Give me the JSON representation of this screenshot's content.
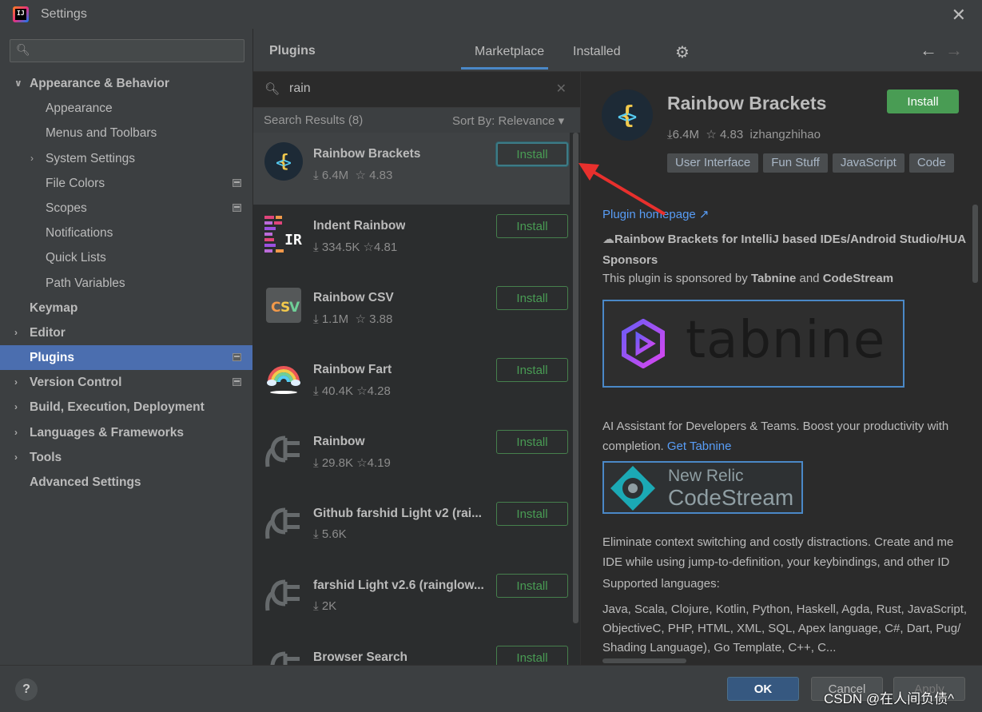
{
  "window": {
    "title": "Settings",
    "app_icon_text": "IJ"
  },
  "sidebar": {
    "search_placeholder": "",
    "items": [
      {
        "label": "Appearance & Behavior",
        "expanded": true
      },
      {
        "label": "Appearance"
      },
      {
        "label": "Menus and Toolbars"
      },
      {
        "label": "System Settings"
      },
      {
        "label": "File Colors"
      },
      {
        "label": "Scopes"
      },
      {
        "label": "Notifications"
      },
      {
        "label": "Quick Lists"
      },
      {
        "label": "Path Variables"
      },
      {
        "label": "Keymap"
      },
      {
        "label": "Editor"
      },
      {
        "label": "Plugins",
        "selected": true
      },
      {
        "label": "Version Control"
      },
      {
        "label": "Build, Execution, Deployment"
      },
      {
        "label": "Languages & Frameworks"
      },
      {
        "label": "Tools"
      },
      {
        "label": "Advanced Settings"
      }
    ]
  },
  "plugins_header": {
    "title": "Plugins",
    "tabs": [
      {
        "label": "Marketplace",
        "active": true
      },
      {
        "label": "Installed"
      }
    ]
  },
  "search": {
    "query": "rain",
    "results_label": "Search Results (8)",
    "sort_label": "Sort By: Relevance"
  },
  "plugins": [
    {
      "name": "Rainbow Brackets",
      "downloads": "6.4M",
      "rating": "4.83",
      "install": "Install",
      "icon": "rainbow-brackets-icon"
    },
    {
      "name": "Indent Rainbow",
      "downloads": "334.5K",
      "rating": "4.81",
      "install": "Install",
      "icon": "indent-rainbow-icon"
    },
    {
      "name": "Rainbow CSV",
      "downloads": "1.1M",
      "rating": "3.88",
      "install": "Install",
      "icon": "csv-icon"
    },
    {
      "name": "Rainbow Fart",
      "downloads": "40.4K",
      "rating": "4.28",
      "install": "Install",
      "icon": "rainbow-icon"
    },
    {
      "name": "Rainbow",
      "downloads": "29.8K",
      "rating": "4.19",
      "install": "Install",
      "icon": "plug-icon"
    },
    {
      "name": "Github farshid Light v2 (rai...",
      "downloads": "5.6K",
      "rating": "",
      "install": "Install",
      "icon": "plug-icon"
    },
    {
      "name": "farshid Light v2.6 (rainglow...",
      "downloads": "2K",
      "rating": "",
      "install": "Install",
      "icon": "plug-icon"
    },
    {
      "name": "Browser Search",
      "downloads": "",
      "rating": "",
      "install": "Install",
      "icon": "plug-icon"
    }
  ],
  "detail": {
    "name": "Rainbow Brackets",
    "install": "Install",
    "downloads": "6.4M",
    "rating": "4.83",
    "vendor": "izhangzhihao",
    "tags": [
      "User Interface",
      "Fun Stuff",
      "JavaScript",
      "Code"
    ],
    "homepage": "Plugin homepage ↗",
    "headline": "Rainbow Brackets for IntelliJ based IDEs/Android Studio/HUA",
    "sponsors_title": "Sponsors",
    "sponsor_text_a": "This plugin is sponsored by ",
    "sponsor_1": "Tabnine",
    "sponsor_and": " and ",
    "sponsor_2": "CodeStream",
    "tabnine_word": "tabnine",
    "ai_text": "AI Assistant for Developers & Teams. Boost your productivity with",
    "ai_text_2": "completion. ",
    "get_tabnine": "Get Tabnine",
    "cs_line1": "New Relic",
    "cs_line2": "CodeStream",
    "cs_text_1": "Eliminate context switching and costly distractions. Create and me",
    "cs_text_2": "IDE while using jump-to-definition, your keybindings, and other ID",
    "supported": "Supported languages:",
    "langs_1": "Java, Scala, Clojure, Kotlin, Python, Haskell, Agda, Rust, JavaScript,",
    "langs_2": "ObjectiveC, PHP, HTML, XML, SQL, Apex language, C#, Dart, Pug/",
    "langs_3": "Shading Language), Go Template, C++, C..."
  },
  "footer": {
    "help": "?",
    "ok": "OK",
    "cancel": "Cancel",
    "apply": "Apply"
  },
  "watermark": "CSDN @在人间负债^",
  "colors": {
    "selection": "#4b6eaf",
    "install_green": "#499c54",
    "link": "#589df6",
    "annotation_arrow": "#e8302d"
  }
}
